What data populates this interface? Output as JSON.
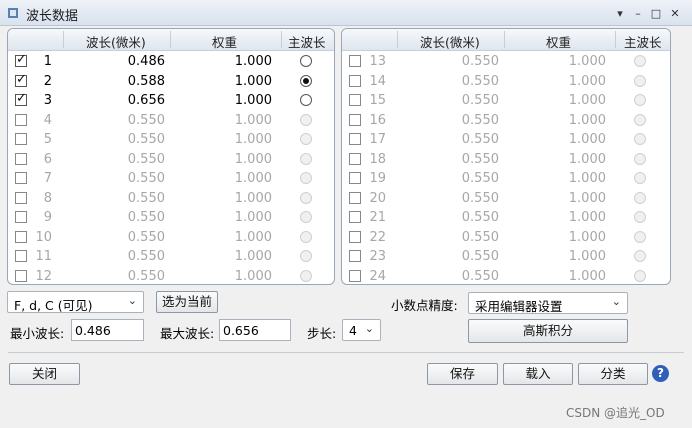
{
  "window": {
    "title": "波长数据",
    "menu_glyph": "▾",
    "min_glyph": "–",
    "max_glyph": "□",
    "close_glyph": "✕"
  },
  "table": {
    "headers": {
      "wavelength": "波长(微米)",
      "weight": "权重",
      "primary": "主波长"
    },
    "left_rows": [
      {
        "n": "1",
        "checked": true,
        "wavelength": "0.486",
        "weight": "1.000",
        "primary": false,
        "enabled": true
      },
      {
        "n": "2",
        "checked": true,
        "wavelength": "0.588",
        "weight": "1.000",
        "primary": true,
        "enabled": true
      },
      {
        "n": "3",
        "checked": true,
        "wavelength": "0.656",
        "weight": "1.000",
        "primary": false,
        "enabled": true
      },
      {
        "n": "4",
        "checked": false,
        "wavelength": "0.550",
        "weight": "1.000",
        "primary": false,
        "enabled": false
      },
      {
        "n": "5",
        "checked": false,
        "wavelength": "0.550",
        "weight": "1.000",
        "primary": false,
        "enabled": false
      },
      {
        "n": "6",
        "checked": false,
        "wavelength": "0.550",
        "weight": "1.000",
        "primary": false,
        "enabled": false
      },
      {
        "n": "7",
        "checked": false,
        "wavelength": "0.550",
        "weight": "1.000",
        "primary": false,
        "enabled": false
      },
      {
        "n": "8",
        "checked": false,
        "wavelength": "0.550",
        "weight": "1.000",
        "primary": false,
        "enabled": false
      },
      {
        "n": "9",
        "checked": false,
        "wavelength": "0.550",
        "weight": "1.000",
        "primary": false,
        "enabled": false
      },
      {
        "n": "10",
        "checked": false,
        "wavelength": "0.550",
        "weight": "1.000",
        "primary": false,
        "enabled": false
      },
      {
        "n": "11",
        "checked": false,
        "wavelength": "0.550",
        "weight": "1.000",
        "primary": false,
        "enabled": false
      },
      {
        "n": "12",
        "checked": false,
        "wavelength": "0.550",
        "weight": "1.000",
        "primary": false,
        "enabled": false
      }
    ],
    "right_rows": [
      {
        "n": "13",
        "checked": false,
        "wavelength": "0.550",
        "weight": "1.000",
        "primary": false,
        "enabled": false
      },
      {
        "n": "14",
        "checked": false,
        "wavelength": "0.550",
        "weight": "1.000",
        "primary": false,
        "enabled": false
      },
      {
        "n": "15",
        "checked": false,
        "wavelength": "0.550",
        "weight": "1.000",
        "primary": false,
        "enabled": false
      },
      {
        "n": "16",
        "checked": false,
        "wavelength": "0.550",
        "weight": "1.000",
        "primary": false,
        "enabled": false
      },
      {
        "n": "17",
        "checked": false,
        "wavelength": "0.550",
        "weight": "1.000",
        "primary": false,
        "enabled": false
      },
      {
        "n": "18",
        "checked": false,
        "wavelength": "0.550",
        "weight": "1.000",
        "primary": false,
        "enabled": false
      },
      {
        "n": "19",
        "checked": false,
        "wavelength": "0.550",
        "weight": "1.000",
        "primary": false,
        "enabled": false
      },
      {
        "n": "20",
        "checked": false,
        "wavelength": "0.550",
        "weight": "1.000",
        "primary": false,
        "enabled": false
      },
      {
        "n": "21",
        "checked": false,
        "wavelength": "0.550",
        "weight": "1.000",
        "primary": false,
        "enabled": false
      },
      {
        "n": "22",
        "checked": false,
        "wavelength": "0.550",
        "weight": "1.000",
        "primary": false,
        "enabled": false
      },
      {
        "n": "23",
        "checked": false,
        "wavelength": "0.550",
        "weight": "1.000",
        "primary": false,
        "enabled": false
      },
      {
        "n": "24",
        "checked": false,
        "wavelength": "0.550",
        "weight": "1.000",
        "primary": false,
        "enabled": false
      }
    ]
  },
  "controls": {
    "preset": "F, d, C (可见)",
    "select_current": "选为当前",
    "decimal_label": "小数点精度:",
    "decimal_value": "采用编辑器设置",
    "gauss": "高斯积分",
    "min_label": "最小波长:",
    "min_value": "0.486",
    "max_label": "最大波长:",
    "max_value": "0.656",
    "step_label": "步长:",
    "step_value": "4",
    "arrow_glyph": "⌄"
  },
  "buttons": {
    "close": "关闭",
    "save": "保存",
    "load": "载入",
    "sort": "分类",
    "help": "?"
  },
  "watermark": "CSDN @追光_OD",
  "colors": {
    "dim_text": "#a7a7a7",
    "help_blue": "#2f5fb8"
  }
}
